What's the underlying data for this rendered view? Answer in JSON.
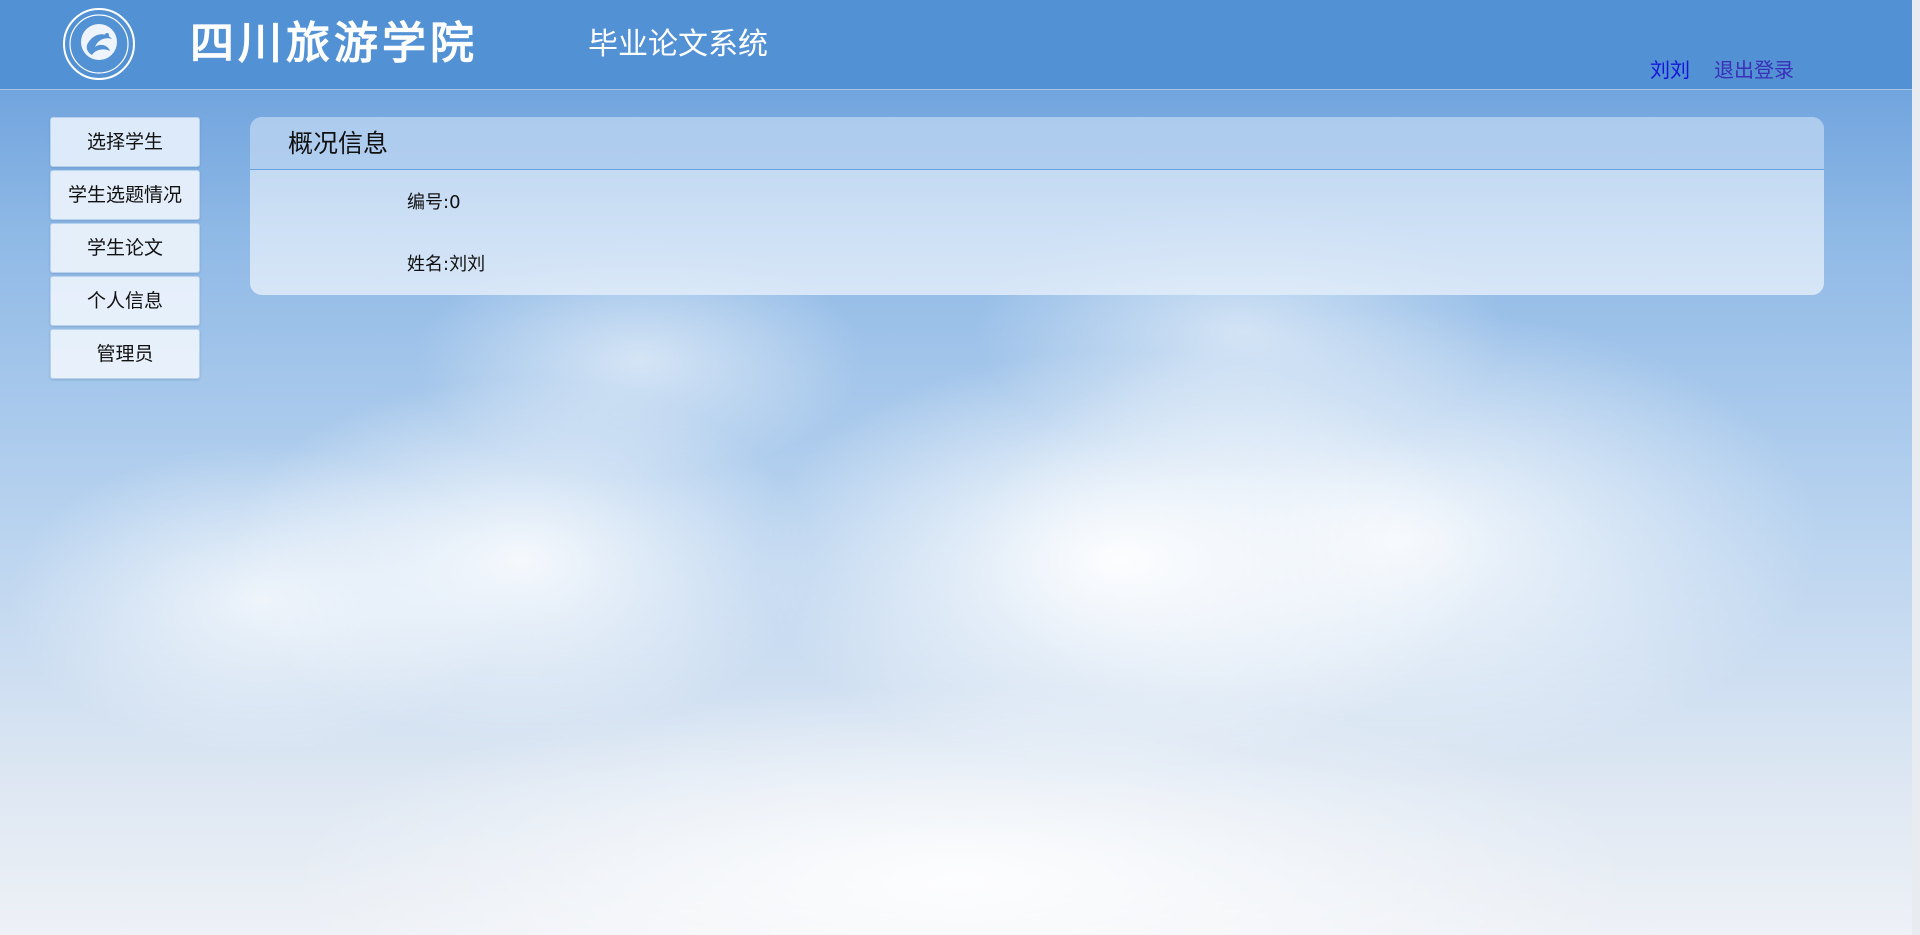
{
  "header": {
    "school_name": "四川旅游学院",
    "system_name": "毕业论文系统",
    "user_name": "刘刘",
    "logout_label": "退出登录"
  },
  "sidebar": {
    "items": [
      {
        "label": "选择学生"
      },
      {
        "label": "学生选题情况"
      },
      {
        "label": "学生论文"
      },
      {
        "label": "个人信息"
      },
      {
        "label": "管理员"
      }
    ]
  },
  "panel": {
    "title": "概况信息",
    "fields": [
      {
        "label": "编号:",
        "value": "0"
      },
      {
        "label": "姓名:",
        "value": "刘刘"
      }
    ]
  },
  "colors": {
    "header_bg": "#5391d5",
    "link_user": "#1515d8",
    "link_logout": "#3a2fb8"
  }
}
